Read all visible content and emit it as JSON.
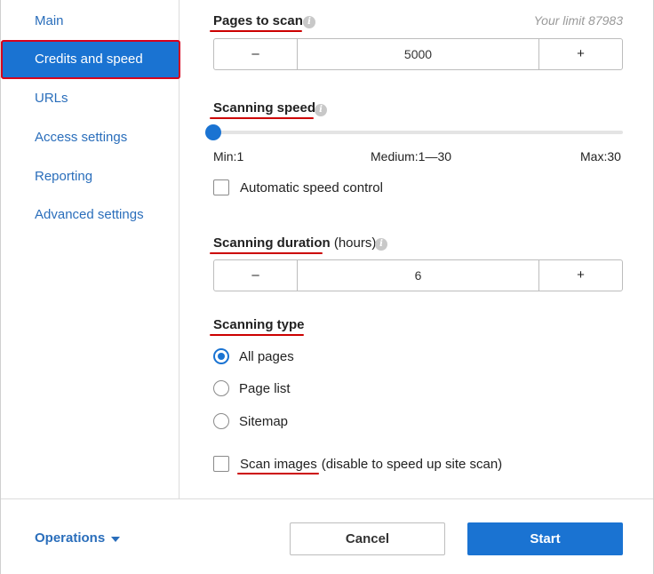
{
  "sidebar": {
    "items": [
      {
        "label": "Main"
      },
      {
        "label": "Credits and speed",
        "active": true
      },
      {
        "label": "URLs"
      },
      {
        "label": "Access settings"
      },
      {
        "label": "Reporting"
      },
      {
        "label": "Advanced settings"
      }
    ]
  },
  "pages_to_scan": {
    "title": "Pages to scan",
    "limit_text": "Your limit 87983",
    "decrement": "–",
    "value": "5000",
    "increment": "+"
  },
  "scanning_speed": {
    "title": "Scanning speed",
    "min_label": "Min:1",
    "medium_label": "Medium:1—30",
    "max_label": "Max:30",
    "current_value": 1,
    "auto_label": "Automatic speed control",
    "auto_checked": false
  },
  "scanning_duration": {
    "title": "Scanning duration",
    "unit": "(hours)",
    "decrement": "–",
    "value": "6",
    "increment": "+"
  },
  "scanning_type": {
    "title": "Scanning type",
    "options": [
      {
        "label": "All pages",
        "checked": true
      },
      {
        "label": "Page list",
        "checked": false
      },
      {
        "label": "Sitemap",
        "checked": false
      }
    ]
  },
  "scan_images": {
    "label": "Scan images",
    "hint": "(disable to speed up site scan)",
    "checked": false
  },
  "footer": {
    "operations_label": "Operations",
    "cancel_label": "Cancel",
    "start_label": "Start"
  },
  "colors": {
    "accent": "#1a73d2",
    "link": "#2a6ebb",
    "annotation": "#cc0000"
  },
  "icons": [
    "info-icon",
    "caret-down-icon"
  ]
}
